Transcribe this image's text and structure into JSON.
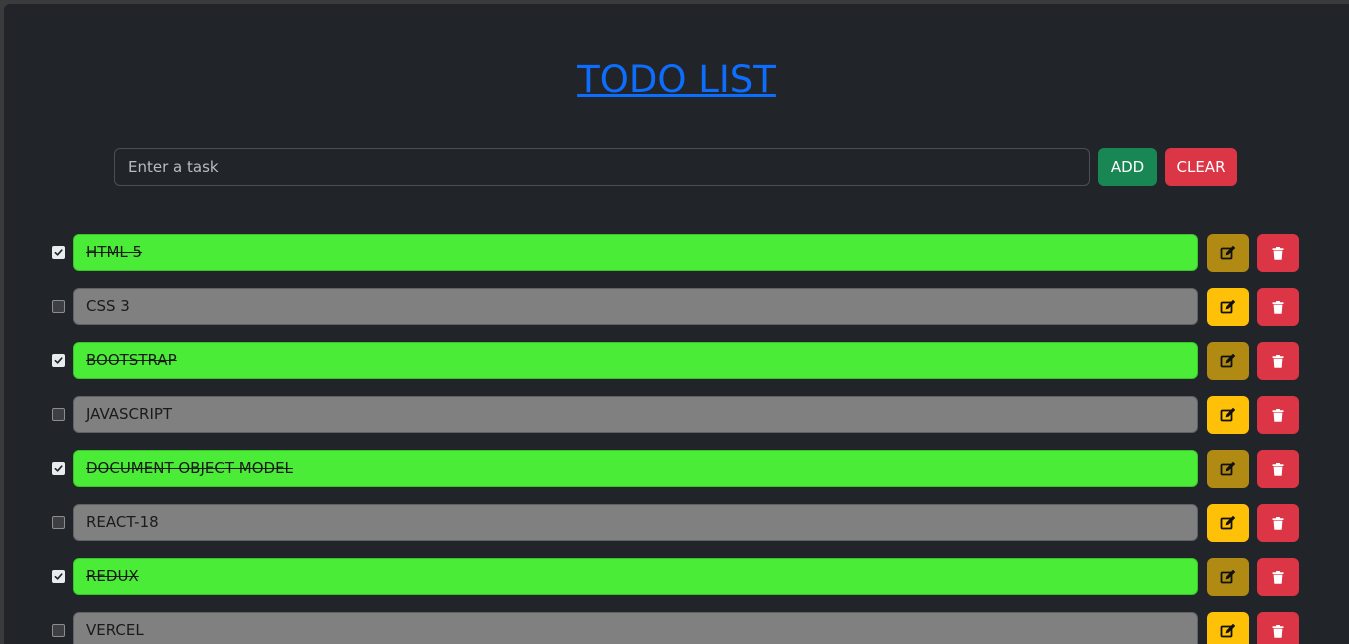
{
  "app": {
    "title": "TODO LIST"
  },
  "input": {
    "placeholder": "Enter a task",
    "value": ""
  },
  "buttons": {
    "add_label": "ADD",
    "clear_label": "CLEAR"
  },
  "colors": {
    "page_bg": "#212529",
    "title": "#0d6efd",
    "done_task": "#4bec37",
    "pending_task": "#808080",
    "add_button": "#198754",
    "clear_button": "#dc3545",
    "edit_button": "#ffc107",
    "edit_button_disabled": "#b08a12",
    "delete_button": "#dc3545"
  },
  "icons": {
    "edit": "edit-icon",
    "delete": "trash-icon",
    "check": "checkmark-icon"
  },
  "tasks": [
    {
      "text": "HTML 5",
      "completed": true
    },
    {
      "text": "CSS 3",
      "completed": false
    },
    {
      "text": "BOOTSTRAP",
      "completed": true
    },
    {
      "text": "JAVASCRIPT",
      "completed": false
    },
    {
      "text": "DOCUMENT OBJECT MODEL",
      "completed": true
    },
    {
      "text": "REACT-18",
      "completed": false
    },
    {
      "text": "REDUX",
      "completed": true
    },
    {
      "text": "VERCEL",
      "completed": false
    }
  ]
}
